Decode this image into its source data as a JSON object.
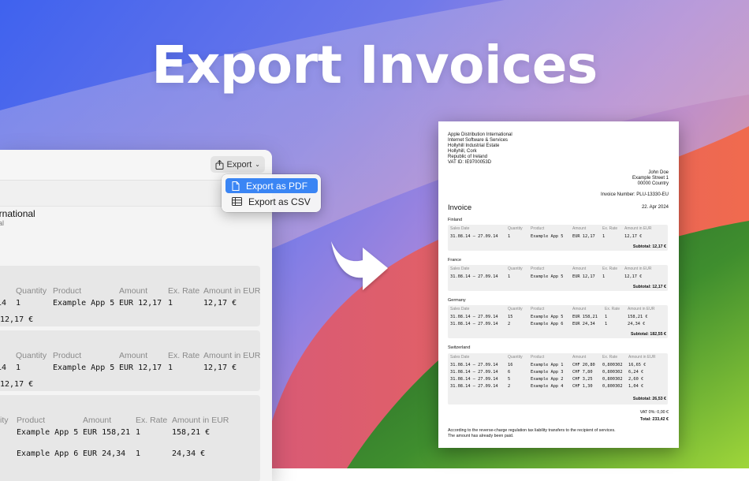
{
  "headline": "Export Invoices",
  "window": {
    "export_label": "Export",
    "company_title": "ernational",
    "company_sub": "al",
    "cards": [
      {
        "headers": [
          "Quantity",
          "Product",
          "Amount",
          "Ex. Rate",
          "Amount in EUR"
        ],
        "values": [
          "14",
          "1",
          "Example App 5",
          "EUR 12,17",
          "1",
          "12,17 €"
        ],
        "subtotal": "12,17 €"
      },
      {
        "headers": [
          "Quantity",
          "Product",
          "Amount",
          "Ex. Rate",
          "Amount in EUR"
        ],
        "values": [
          "14",
          "1",
          "Example App 5",
          "EUR 12,17",
          "1",
          "12,17 €"
        ],
        "subtotal": "12,17 €"
      },
      {
        "headers": [
          "ity",
          "Product",
          "Amount",
          "Ex. Rate",
          "Amount in EUR"
        ],
        "rows": [
          [
            "Example App 5",
            "EUR 158,21",
            "1",
            "158,21 €"
          ],
          [
            "Example App 6",
            "EUR 24,34",
            "1",
            "24,34 €"
          ]
        ]
      }
    ]
  },
  "menu": {
    "items": [
      "Export as PDF",
      "Export as CSV"
    ],
    "selected": "Export as PDF"
  },
  "invoice": {
    "sender": [
      "Apple Distribution International",
      "Internet Software & Services",
      "Hollyhill Industrial Estate",
      "Hollyhill, Cork",
      "Republic of Ireland",
      "VAT ID: IE9700053D"
    ],
    "recipient": [
      "John Doe",
      "Example Street 1",
      "00000 Country"
    ],
    "invoice_number": "Invoice Number: PLU-13330-EU",
    "title": "Invoice",
    "date": "22. Apr 2024",
    "columns": [
      "Sales Date",
      "Quantity",
      "Product",
      "Amount",
      "Ex. Rate",
      "Amount in EUR"
    ],
    "sections": [
      {
        "country": "Finland",
        "rows": [
          [
            "31.08.14 – 27.09.14",
            "1",
            "Example App 5",
            "EUR 12,17",
            "1",
            "12,17 €"
          ]
        ],
        "subtotal": "Subtotal: 12,17 €"
      },
      {
        "country": "France",
        "rows": [
          [
            "31.08.14 – 27.09.14",
            "1",
            "Example App 5",
            "EUR 12,17",
            "1",
            "12,17 €"
          ]
        ],
        "subtotal": "Subtotal: 12,17 €"
      },
      {
        "country": "Germany",
        "rows": [
          [
            "31.08.14 – 27.09.14",
            "15",
            "Example App 5",
            "EUR 158,21",
            "1",
            "158,21 €"
          ],
          [
            "31.08.14 – 27.09.14",
            "2",
            "Example App 6",
            "EUR 24,34",
            "1",
            "24,34 €"
          ]
        ],
        "subtotal": "Subtotal: 182,55 €"
      },
      {
        "country": "Switzerland",
        "rows": [
          [
            "31.08.14 – 27.09.14",
            "16",
            "Example App 1",
            "CHF 20,80",
            "0,800302",
            "16,65 €"
          ],
          [
            "31.08.14 – 27.09.14",
            "6",
            "Example App 3",
            "CHF 7,80",
            "0,800302",
            "6,24 €"
          ],
          [
            "31.08.14 – 27.09.14",
            "5",
            "Example App 2",
            "CHF 3,25",
            "0,800302",
            "2,60 €"
          ],
          [
            "31.08.14 – 27.09.14",
            "2",
            "Example App 4",
            "CHF 1,30",
            "0,800302",
            "1,04 €"
          ]
        ],
        "subtotal": "Subtotal: 26,53 €"
      }
    ],
    "vat": "VAT 0%: 0,00 €",
    "total": "Total: 233,42 €",
    "footer": [
      "According to the reverse-charge regulation tax liability transfers to the recipient of services.",
      "The amount has already been paid."
    ]
  }
}
